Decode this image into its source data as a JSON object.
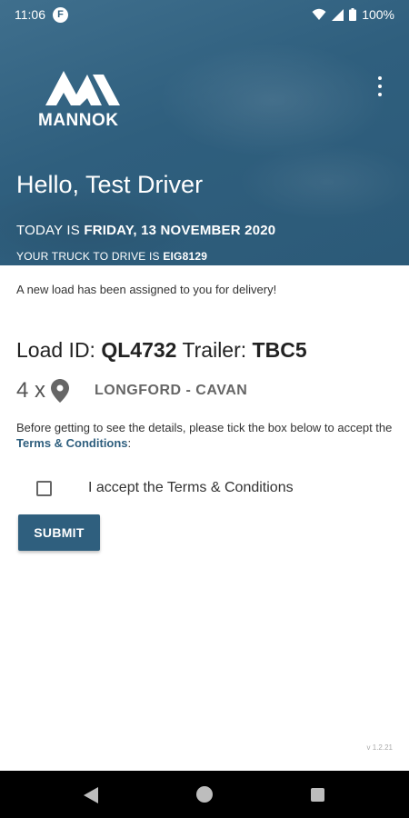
{
  "status_bar": {
    "time": "11:06",
    "app_icon_letter": "F",
    "battery": "100%"
  },
  "header": {
    "brand": "MANNOK",
    "greeting": "Hello, Test Driver",
    "today_prefix": "TODAY IS",
    "today_date": "FRIDAY, 13 NOVEMBER 2020",
    "truck_prefix": "YOUR TRUCK TO DRIVE IS",
    "truck_id": "EIG8129"
  },
  "main": {
    "notice": "A new load has been assigned to you for delivery!",
    "load_label": "Load ID:",
    "load_id": "QL4732",
    "trailer_label": "Trailer:",
    "trailer_id": "TBC5",
    "stops_count": "4 x",
    "route": "LONGFORD - CAVAN",
    "terms_text_before": "Before getting to see the details, please tick the box below to accept the ",
    "terms_link": "Terms & Conditions",
    "terms_text_after": ":",
    "checkbox_label": "I accept the Terms & Conditions",
    "checkbox_checked": false,
    "submit_label": "SUBMIT",
    "version": "v 1.2.21"
  },
  "icons": {
    "menu": "more-vert-icon",
    "location": "location-pin-icon",
    "nav_back": "back-icon",
    "nav_home": "home-icon",
    "nav_recent": "recent-apps-icon"
  },
  "colors": {
    "brand": "#2f5f7e",
    "header_bg": "#3a6a89",
    "nav_bar": "#000000"
  }
}
